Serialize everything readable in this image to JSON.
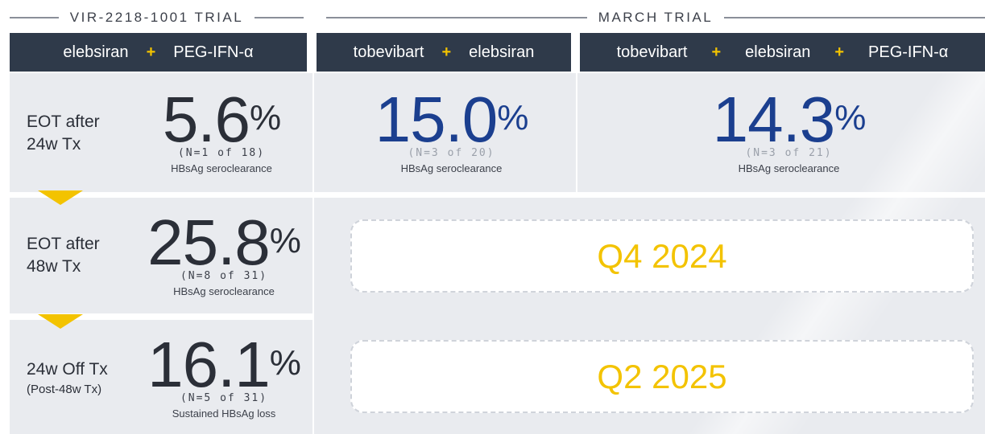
{
  "headers": {
    "vir_trial": "VIR-2218-1001 TRIAL",
    "march_trial": "MARCH TRIAL"
  },
  "combos": [
    {
      "drugs": [
        "elebsiran",
        "PEG-IFN-α"
      ]
    },
    {
      "drugs": [
        "tobevibart",
        "elebsiran"
      ]
    },
    {
      "drugs": [
        "tobevibart",
        "elebsiran",
        "PEG-IFN-α"
      ]
    }
  ],
  "plus_sign": "+",
  "rows": [
    {
      "label_line1": "EOT after",
      "label_line2": "24w Tx"
    },
    {
      "label_line1": "EOT after",
      "label_line2": "48w Tx"
    },
    {
      "label_line1": "24w Off Tx",
      "label_line2": "(Post-48w Tx)"
    }
  ],
  "stats": {
    "vir_24w": {
      "value": "5.6",
      "unit": "%",
      "n": "(N=1 of 18)",
      "metric": "HBsAg seroclearance"
    },
    "march_tobe_ele_24w": {
      "value": "15.0",
      "unit": "%",
      "n": "(N=3 of 20)",
      "metric": "HBsAg seroclearance"
    },
    "march_triple_24w": {
      "value": "14.3",
      "unit": "%",
      "n": "(N=3 of 21)",
      "metric": "HBsAg seroclearance"
    },
    "vir_48w": {
      "value": "25.8",
      "unit": "%",
      "n": "(N=8 of 31)",
      "metric": "HBsAg seroclearance"
    },
    "vir_offtx": {
      "value": "16.1",
      "unit": "%",
      "n": "(N=5 of 31)",
      "metric": "Sustained HBsAg loss"
    }
  },
  "pending": {
    "row2": "Q4 2024",
    "row3": "Q2 2025"
  },
  "colors": {
    "header_bar": "#2f3a4a",
    "accent_yellow": "#f3c300",
    "stat_blue": "#1b3f8f",
    "panel_grey": "#e9ebef"
  }
}
